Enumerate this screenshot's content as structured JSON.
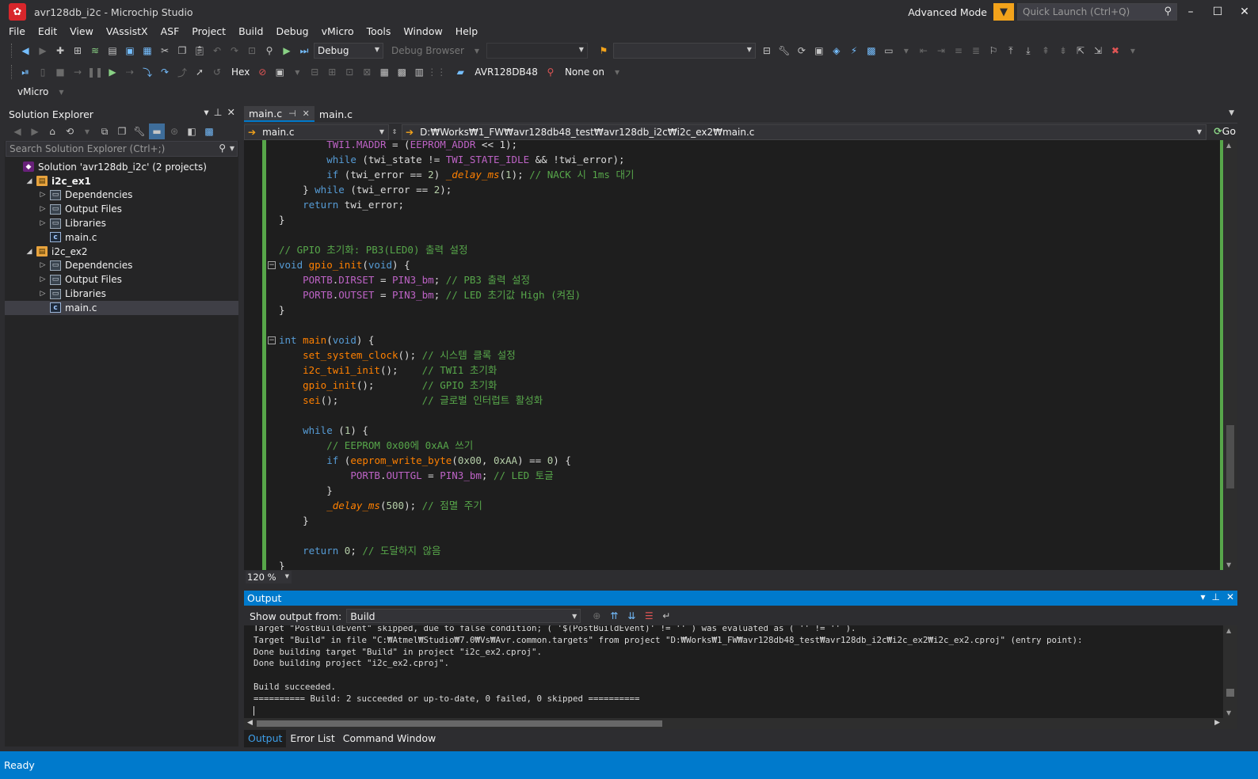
{
  "window": {
    "title": "avr128db_i2c - Microchip Studio",
    "mode_label": "Advanced Mode",
    "quick_launch_placeholder": "Quick Launch (Ctrl+Q)"
  },
  "menu": [
    "File",
    "Edit",
    "View",
    "VAssistX",
    "ASF",
    "Project",
    "Build",
    "Debug",
    "vMicro",
    "Tools",
    "Window",
    "Help"
  ],
  "toolbar": {
    "configuration": "Debug",
    "debug_browser": "Debug Browser",
    "hex_label": "Hex",
    "device": "AVR128DB48",
    "tool": "None on",
    "vmicro": "vMicro"
  },
  "solution_explorer": {
    "title": "Solution Explorer",
    "search_placeholder": "Search Solution Explorer (Ctrl+;)",
    "items": [
      {
        "label": "Solution 'avr128db_i2c' (2 projects)",
        "level": 0,
        "icon": "solution-icon",
        "twisty": "",
        "bold": false,
        "selected": false
      },
      {
        "label": "i2c_ex1",
        "level": 1,
        "icon": "project-icon",
        "twisty": "◢",
        "bold": true,
        "selected": false
      },
      {
        "label": "Dependencies",
        "level": 2,
        "icon": "folder-icon",
        "twisty": "▷",
        "bold": false,
        "selected": false
      },
      {
        "label": "Output Files",
        "level": 2,
        "icon": "folder-icon",
        "twisty": "▷",
        "bold": false,
        "selected": false
      },
      {
        "label": "Libraries",
        "level": 2,
        "icon": "folder-icon",
        "twisty": "▷",
        "bold": false,
        "selected": false
      },
      {
        "label": "main.c",
        "level": 2,
        "icon": "c-file-icon",
        "twisty": "",
        "bold": false,
        "selected": false
      },
      {
        "label": "i2c_ex2",
        "level": 1,
        "icon": "project-icon",
        "twisty": "◢",
        "bold": false,
        "selected": false
      },
      {
        "label": "Dependencies",
        "level": 2,
        "icon": "folder-icon",
        "twisty": "▷",
        "bold": false,
        "selected": false
      },
      {
        "label": "Output Files",
        "level": 2,
        "icon": "folder-icon",
        "twisty": "▷",
        "bold": false,
        "selected": false
      },
      {
        "label": "Libraries",
        "level": 2,
        "icon": "folder-icon",
        "twisty": "▷",
        "bold": false,
        "selected": false
      },
      {
        "label": "main.c",
        "level": 2,
        "icon": "c-file-icon",
        "twisty": "",
        "bold": false,
        "selected": true
      }
    ]
  },
  "editor": {
    "tabs": [
      {
        "label": "main.c",
        "active": true,
        "pin": "⊣",
        "close": "✕"
      },
      {
        "label": "main.c",
        "active": false,
        "pin": "",
        "close": ""
      }
    ],
    "nav_file": "main.c",
    "nav_path": "D:₩Works₩1_FW₩avr128db48_test₩avr128db_i2c₩i2c_ex2₩main.c",
    "go_label": "Go",
    "zoom": "120 %",
    "lines": [
      {
        "fold": "",
        "tokens": [
          [
            "",
            "        "
          ],
          [
            "mac",
            "TWI1.MADDR"
          ],
          [
            "",
            " = ("
          ],
          [
            "mac",
            "EEPROM_ADDR"
          ],
          [
            "",
            " << 1);"
          ]
        ]
      },
      {
        "fold": "",
        "tokens": [
          [
            "",
            "        "
          ],
          [
            "kw",
            "while"
          ],
          [
            "",
            " (twi_state != "
          ],
          [
            "mac",
            "TWI_STATE_IDLE"
          ],
          [
            "",
            " && !twi_error);"
          ]
        ]
      },
      {
        "fold": "",
        "tokens": [
          [
            "",
            "        "
          ],
          [
            "kw",
            "if"
          ],
          [
            "",
            " (twi_error == "
          ],
          [
            "num",
            "2"
          ],
          [
            "",
            ") "
          ],
          [
            "fi",
            "_delay_ms"
          ],
          [
            "",
            "("
          ],
          [
            "num",
            "1"
          ],
          [
            "",
            "); "
          ],
          [
            "cm",
            "// NACK 시 1ms 대기"
          ]
        ]
      },
      {
        "fold": "",
        "tokens": [
          [
            "",
            "    } "
          ],
          [
            "kw",
            "while"
          ],
          [
            "",
            " (twi_error == "
          ],
          [
            "num",
            "2"
          ],
          [
            "",
            ");"
          ]
        ]
      },
      {
        "fold": "",
        "tokens": [
          [
            "",
            "    "
          ],
          [
            "kw",
            "return"
          ],
          [
            "",
            " twi_error;"
          ]
        ]
      },
      {
        "fold": "",
        "tokens": [
          [
            "",
            "}"
          ]
        ]
      },
      {
        "fold": "",
        "tokens": [
          [
            "",
            ""
          ]
        ]
      },
      {
        "fold": "",
        "tokens": [
          [
            "cm",
            "// GPIO 초기화: PB3(LED0) 출력 설정"
          ]
        ]
      },
      {
        "fold": "⊟",
        "tokens": [
          [
            "kw",
            "void"
          ],
          [
            "",
            " "
          ],
          [
            "fn",
            "gpio_init"
          ],
          [
            "",
            "("
          ],
          [
            "kw",
            "void"
          ],
          [
            "",
            ") {"
          ]
        ]
      },
      {
        "fold": "",
        "tokens": [
          [
            "",
            "    "
          ],
          [
            "mac",
            "PORTB"
          ],
          [
            "",
            "."
          ],
          [
            "mac",
            "DIRSET"
          ],
          [
            "",
            " = "
          ],
          [
            "mac",
            "PIN3_bm"
          ],
          [
            "",
            "; "
          ],
          [
            "cm",
            "// PB3 출력 설정"
          ]
        ]
      },
      {
        "fold": "",
        "tokens": [
          [
            "",
            "    "
          ],
          [
            "mac",
            "PORTB"
          ],
          [
            "",
            "."
          ],
          [
            "mac",
            "OUTSET"
          ],
          [
            "",
            " = "
          ],
          [
            "mac",
            "PIN3_bm"
          ],
          [
            "",
            "; "
          ],
          [
            "cm",
            "// LED 초기값 High (켜짐)"
          ]
        ]
      },
      {
        "fold": "",
        "tokens": [
          [
            "",
            "}"
          ]
        ]
      },
      {
        "fold": "",
        "tokens": [
          [
            "",
            ""
          ]
        ]
      },
      {
        "fold": "⊟",
        "tokens": [
          [
            "kw",
            "int"
          ],
          [
            "",
            " "
          ],
          [
            "fn",
            "main"
          ],
          [
            "",
            "("
          ],
          [
            "kw",
            "void"
          ],
          [
            "",
            ") {"
          ]
        ]
      },
      {
        "fold": "",
        "tokens": [
          [
            "",
            "    "
          ],
          [
            "fn",
            "set_system_clock"
          ],
          [
            "",
            "(); "
          ],
          [
            "cm",
            "// 시스템 클록 설정"
          ]
        ]
      },
      {
        "fold": "",
        "tokens": [
          [
            "",
            "    "
          ],
          [
            "fn",
            "i2c_twi1_init"
          ],
          [
            "",
            "();    "
          ],
          [
            "cm",
            "// TWI1 초기화"
          ]
        ]
      },
      {
        "fold": "",
        "tokens": [
          [
            "",
            "    "
          ],
          [
            "fn",
            "gpio_init"
          ],
          [
            "",
            "();        "
          ],
          [
            "cm",
            "// GPIO 초기화"
          ]
        ]
      },
      {
        "fold": "",
        "tokens": [
          [
            "",
            "    "
          ],
          [
            "fn",
            "sei"
          ],
          [
            "",
            "();              "
          ],
          [
            "cm",
            "// 글로벌 인터럽트 활성화"
          ]
        ]
      },
      {
        "fold": "",
        "tokens": [
          [
            "",
            ""
          ]
        ]
      },
      {
        "fold": "",
        "tokens": [
          [
            "",
            "    "
          ],
          [
            "kw",
            "while"
          ],
          [
            "",
            " ("
          ],
          [
            "num",
            "1"
          ],
          [
            "",
            ") {"
          ]
        ]
      },
      {
        "fold": "",
        "tokens": [
          [
            "",
            "        "
          ],
          [
            "cm",
            "// EEPROM 0x00에 0xAA 쓰기"
          ]
        ]
      },
      {
        "fold": "",
        "tokens": [
          [
            "",
            "        "
          ],
          [
            "kw",
            "if"
          ],
          [
            "",
            " ("
          ],
          [
            "fn",
            "eeprom_write_byte"
          ],
          [
            "",
            "("
          ],
          [
            "num",
            "0x00"
          ],
          [
            "",
            ", "
          ],
          [
            "num",
            "0xAA"
          ],
          [
            "",
            ") == "
          ],
          [
            "num",
            "0"
          ],
          [
            "",
            ") {"
          ]
        ]
      },
      {
        "fold": "",
        "tokens": [
          [
            "",
            "            "
          ],
          [
            "mac",
            "PORTB"
          ],
          [
            "",
            "."
          ],
          [
            "mac",
            "OUTTGL"
          ],
          [
            "",
            " = "
          ],
          [
            "mac",
            "PIN3_bm"
          ],
          [
            "",
            "; "
          ],
          [
            "cm",
            "// LED 토글"
          ]
        ]
      },
      {
        "fold": "",
        "tokens": [
          [
            "",
            "        }"
          ]
        ]
      },
      {
        "fold": "",
        "tokens": [
          [
            "",
            "        "
          ],
          [
            "fi",
            "_delay_ms"
          ],
          [
            "",
            "("
          ],
          [
            "num",
            "500"
          ],
          [
            "",
            "); "
          ],
          [
            "cm",
            "// 점멸 주기"
          ]
        ]
      },
      {
        "fold": "",
        "tokens": [
          [
            "",
            "    }"
          ]
        ]
      },
      {
        "fold": "",
        "tokens": [
          [
            "",
            ""
          ]
        ]
      },
      {
        "fold": "",
        "tokens": [
          [
            "",
            "    "
          ],
          [
            "kw",
            "return"
          ],
          [
            "",
            " "
          ],
          [
            "num",
            "0"
          ],
          [
            "",
            "; "
          ],
          [
            "cm",
            "// 도달하지 않음"
          ]
        ]
      },
      {
        "fold": "",
        "tokens": [
          [
            "",
            "}"
          ]
        ]
      }
    ]
  },
  "output": {
    "title": "Output",
    "show_from_label": "Show output from:",
    "source": "Build",
    "lines": [
      "Target \"PostBuildEvent\" skipped, due to false condition; ( '$(PostBuildEvent)' != '' ) was evaluated as ( '' != '' ).",
      "Target \"Build\" in file \"C:₩Atmel₩Studio₩7.0₩Vs₩Avr.common.targets\" from project \"D:₩Works₩1_FW₩avr128db48_test₩avr128db_i2c₩i2c_ex2₩i2c_ex2.cproj\" (entry point):",
      "Done building target \"Build\" in project \"i2c_ex2.cproj\".",
      "Done building project \"i2c_ex2.cproj\".",
      "",
      "Build succeeded.",
      "========== Build: 2 succeeded or up-to-date, 0 failed, 0 skipped =========="
    ],
    "tabs": [
      "Output",
      "Error List",
      "Command Window"
    ]
  },
  "status": {
    "text": "Ready"
  },
  "colors": {
    "accent": "#007acc",
    "background": "#2d2d30",
    "editor_bg": "#1e1e1e",
    "comment": "#57a64a",
    "keyword": "#569cd6",
    "function": "#ff8000",
    "macro": "#bd63c5"
  }
}
